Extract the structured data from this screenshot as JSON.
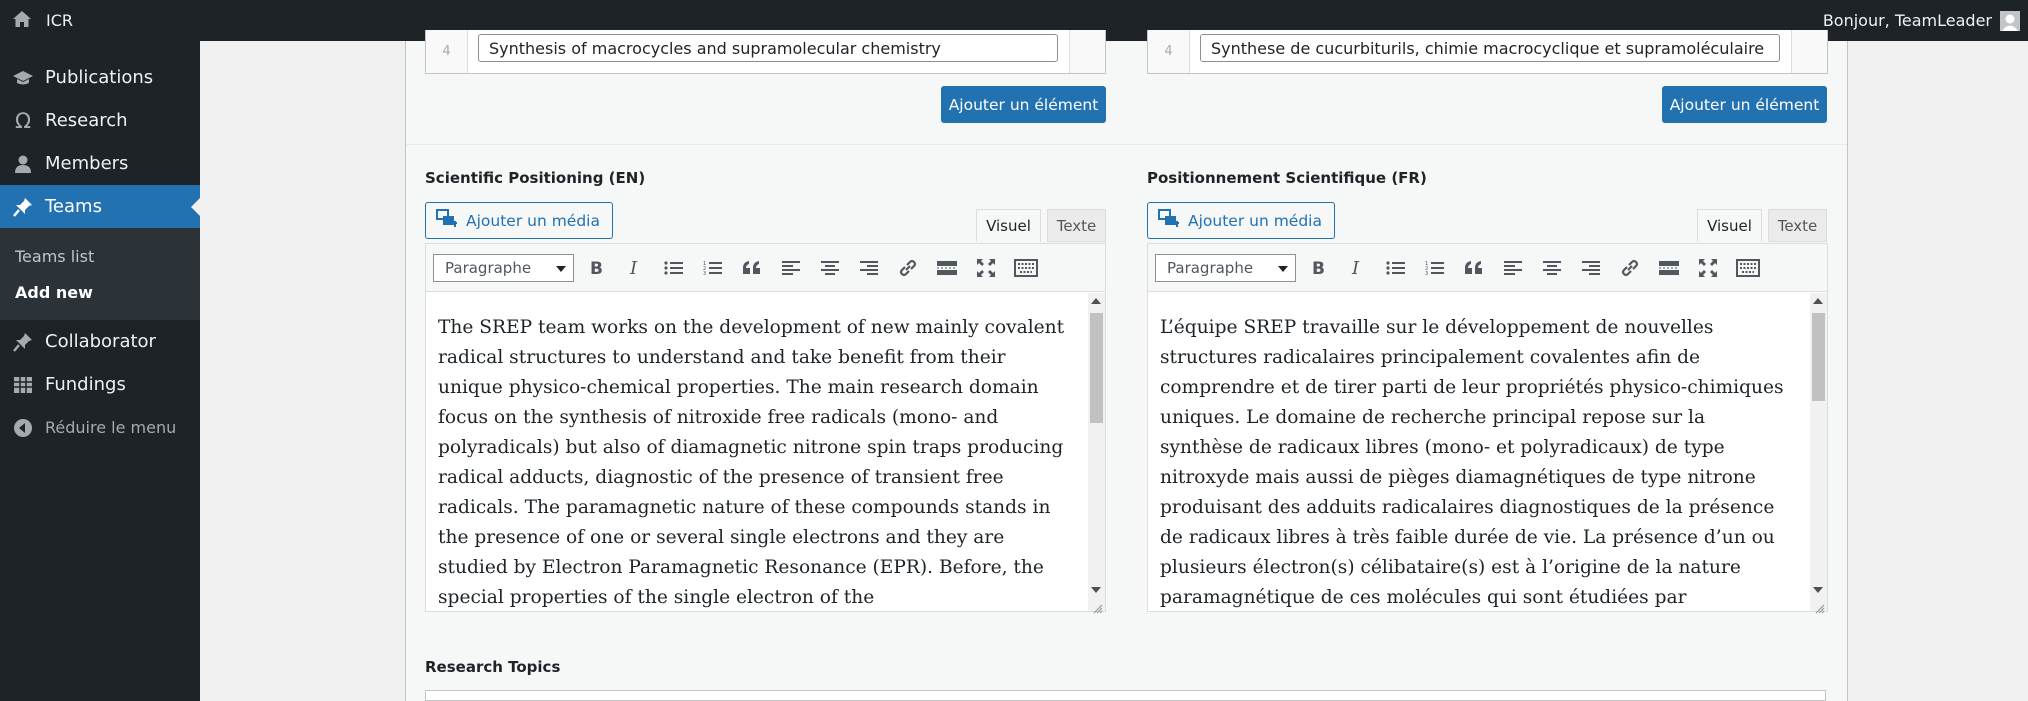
{
  "adminbar": {
    "site_name": "ICR",
    "greeting": "Bonjour, TeamLeader"
  },
  "sidebar": {
    "items": [
      {
        "label": "Publications",
        "icon": "graduation-cap-icon"
      },
      {
        "label": "Research",
        "icon": "omega-icon"
      },
      {
        "label": "Members",
        "icon": "person-icon"
      },
      {
        "label": "Teams",
        "icon": "pin-icon"
      },
      {
        "label": "Collaborator",
        "icon": "pin-icon"
      },
      {
        "label": "Fundings",
        "icon": "grid-icon"
      }
    ],
    "submenu": [
      "Teams list",
      "Add new"
    ],
    "collapse_label": "Réduire le menu"
  },
  "repeater_en": {
    "row_number": "4",
    "value": "Synthesis of macrocycles and supramolecular chemistry",
    "add_label": "Ajouter un élément"
  },
  "repeater_fr": {
    "row_number": "4",
    "value": "Synthese de cucurbiturils, chimie macrocyclique et supramoléculaire",
    "add_label": "Ajouter un élément"
  },
  "editor_en": {
    "label": "Scientific Positioning (EN)",
    "media_label": "Ajouter un média",
    "tab_visual": "Visuel",
    "tab_text": "Texte",
    "format": "Paragraphe",
    "content": "The SREP team works on the development of new mainly covalent radical structures to understand and take benefit from their unique physico-chemical properties. The main research domain focus on the synthesis of nitroxide free radicals (mono- and polyradicals) but also of diamagnetic nitrone spin traps producing radical adducts, diagnostic of the presence of transient free radicals. The paramagnetic nature of these compounds stands in the presence of one or several single electrons and they are studied by Electron Paramagnetic Resonance (EPR). Before, the special properties of the single electron of the"
  },
  "editor_fr": {
    "label": "Positionnement Scientifique (FR)",
    "media_label": "Ajouter un média",
    "tab_visual": "Visuel",
    "tab_text": "Texte",
    "format": "Paragraphe",
    "content": "L’équipe SREP travaille sur le développement de nouvelles structures radicalaires principalement covalentes afin de comprendre et de tirer parti de leur propriétés physico-chimiques uniques. Le domaine de recherche principal repose sur la synthèse de radicaux libres (mono- et polyradicaux) de type nitroxyde mais aussi de pièges diamagnétiques de type nitrone produisant des adduits radicalaires diagnostiques de la présence de radicaux libres à très faible durée de vie. La présence d’un ou plusieurs électron(s) célibataire(s) est à l’origine de la nature paramagnétique de ces molécules qui sont étudiées par Résonance"
  },
  "research_topics": {
    "label": "Research Topics"
  },
  "colors": {
    "admin_dark": "#1d2327",
    "accent": "#2271b1"
  }
}
